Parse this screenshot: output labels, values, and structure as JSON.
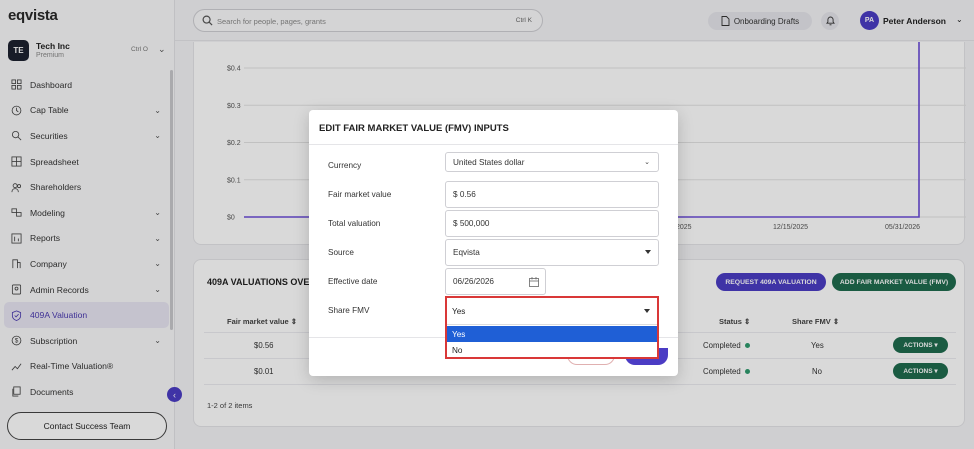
{
  "app": {
    "logo": "eqvista"
  },
  "company": {
    "avatar": "TE",
    "name": "Tech Inc",
    "plan": "Premium",
    "shortcut": "Ctrl O"
  },
  "sidebar": {
    "items": [
      {
        "label": "Dashboard",
        "icon": "dashboard-icon",
        "chevron": false
      },
      {
        "label": "Cap Table",
        "icon": "clock-icon",
        "chevron": true
      },
      {
        "label": "Securities",
        "icon": "securities-icon",
        "chevron": true
      },
      {
        "label": "Spreadsheet",
        "icon": "grid-icon",
        "chevron": false
      },
      {
        "label": "Shareholders",
        "icon": "people-icon",
        "chevron": false
      },
      {
        "label": "Modeling",
        "icon": "modeling-icon",
        "chevron": true
      },
      {
        "label": "Reports",
        "icon": "reports-icon",
        "chevron": true
      },
      {
        "label": "Company",
        "icon": "company-icon",
        "chevron": true
      },
      {
        "label": "Admin Records",
        "icon": "admin-icon",
        "chevron": true
      },
      {
        "label": "409A Valuation",
        "icon": "shield-icon",
        "chevron": false,
        "active": true
      },
      {
        "label": "Subscription",
        "icon": "dollar-icon",
        "chevron": true
      },
      {
        "label": "Real-Time Valuation®",
        "icon": "trend-icon",
        "chevron": false
      },
      {
        "label": "Documents",
        "icon": "documents-icon",
        "chevron": false
      }
    ],
    "contact_label": "Contact Success Team"
  },
  "header": {
    "search_placeholder": "Search for people, pages, grants",
    "search_shortcut": "Ctrl K",
    "drafts_label": "Onboarding Drafts",
    "user_initials": "PA",
    "user_name": "Peter Anderson"
  },
  "chart_data": {
    "type": "line",
    "y_ticks": [
      "$0.4",
      "$0.3",
      "$0.2",
      "$0.1",
      "$0"
    ],
    "x_ticks": [
      "2025",
      "12/15/2025",
      "05/31/2026"
    ],
    "ylim": [
      0,
      0.4
    ],
    "series": [
      {
        "values_visible": [
          0,
          0,
          0,
          0.56
        ]
      }
    ],
    "color": "#6a4cd8"
  },
  "table": {
    "title": "409A VALUATIONS OVE",
    "request_button": "REQUEST 409A VALUATION",
    "add_button": "ADD FAIR MARKET VALUE (FMV)",
    "columns": {
      "fmv": "Fair market value",
      "status": "Status",
      "share_fmv": "Share FMV"
    },
    "rows": [
      {
        "fmv": "$0.56",
        "status": "Completed",
        "share_fmv": "Yes",
        "action": "ACTIONS"
      },
      {
        "fmv": "$0.01",
        "status": "Completed",
        "share_fmv": "No",
        "action": "ACTIONS"
      }
    ],
    "pagination": "1-2 of 2 items"
  },
  "modal": {
    "title": "EDIT FAIR MARKET VALUE (FMV) INPUTS",
    "fields": {
      "currency": {
        "label": "Currency",
        "value": "United States dollar"
      },
      "fmv": {
        "label": "Fair market value",
        "value": "$ 0.56"
      },
      "total": {
        "label": "Total valuation",
        "value": "$ 500,000"
      },
      "source": {
        "label": "Source",
        "value": "Eqvista"
      },
      "date": {
        "label": "Effective date",
        "value": "06/26/2026"
      },
      "share_fmv": {
        "label": "Share FMV",
        "value": "Yes",
        "options": [
          "Yes",
          "No"
        ]
      }
    }
  }
}
